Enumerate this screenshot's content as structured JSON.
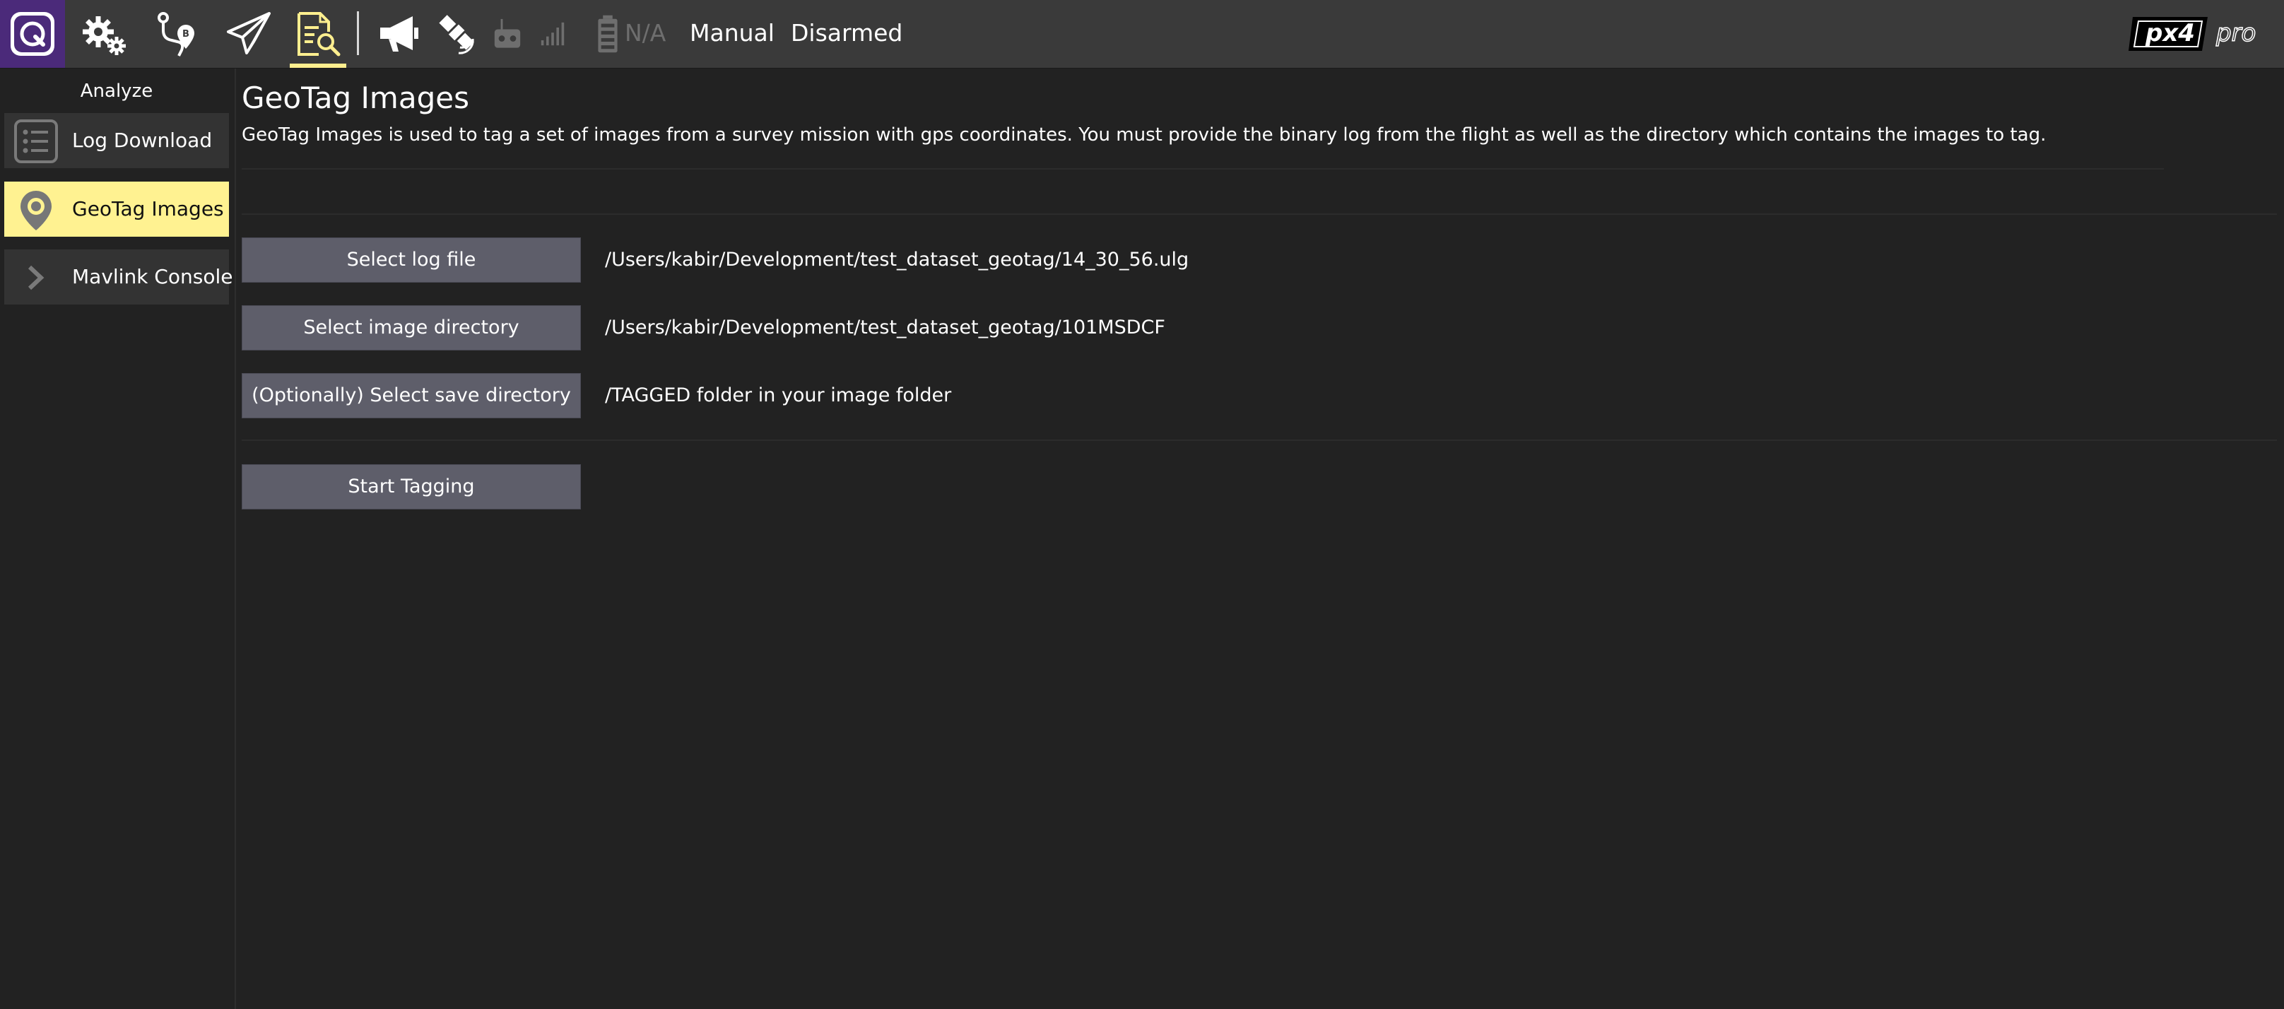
{
  "toolbar": {
    "tools": [
      {
        "name": "settings-gears-icon"
      },
      {
        "name": "plan-route-icon"
      },
      {
        "name": "fly-paper-plane-icon"
      },
      {
        "name": "analyze-document-icon",
        "active": true
      }
    ],
    "status_icons": [
      "megaphone-icon",
      "satellite-icon",
      "rc-transmitter-icon",
      "signal-bars-icon",
      "battery-icon"
    ],
    "battery_text": "N/A",
    "flight_mode": "Manual",
    "arm_state": "Disarmed",
    "active_color": "#ffef8f",
    "brand_color": "#4b2a7a"
  },
  "sidebar": {
    "title": "Analyze",
    "items": [
      {
        "label": "Log Download",
        "icon": "list-icon",
        "active": false
      },
      {
        "label": "GeoTag Images",
        "icon": "map-pin-icon",
        "active": true
      },
      {
        "label": "Mavlink Console",
        "icon": "chevron-right-icon",
        "active": false
      }
    ]
  },
  "main": {
    "title": "GeoTag Images",
    "description": "GeoTag Images is used to tag a set of images from a survey mission with gps coordinates. You must provide the binary log from the flight as well as the directory which contains the images to tag.",
    "log_file": {
      "button": "Select log file",
      "value": "/Users/kabir/Development/test_dataset_geotag/14_30_56.ulg"
    },
    "image_dir": {
      "button": "Select image directory",
      "value": "/Users/kabir/Development/test_dataset_geotag/101MSDCF"
    },
    "save_dir": {
      "button": "(Optionally) Select save directory",
      "value": "/TAGGED folder in your image folder"
    },
    "start_button": "Start Tagging"
  }
}
